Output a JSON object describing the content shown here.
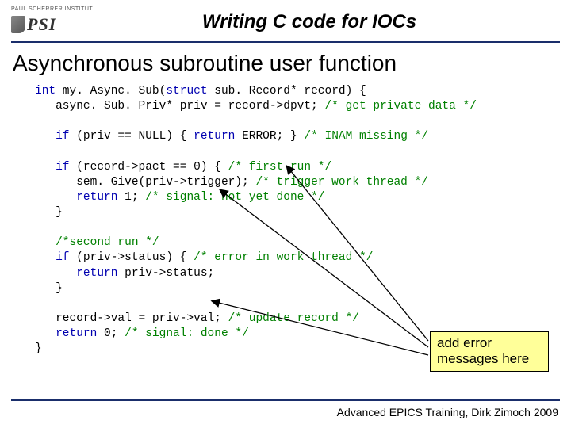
{
  "logo": {
    "institute": "PAUL SCHERRER INSTITUT",
    "letters": "PSI"
  },
  "title": "Writing C code for IOCs",
  "section": "Asynchronous subroutine user function",
  "code": {
    "l1a": "int",
    "l1b": " my. Async. Sub(",
    "l1c": "struct",
    "l1d": " sub. Record* record) {",
    "l2a": "   async. Sub. Priv* priv = record->dpvt; ",
    "l2b": "/* get private data */",
    "l3": "",
    "l4a": "   if",
    "l4b": " (priv == NULL) { ",
    "l4c": "return",
    "l4d": " ERROR; } ",
    "l4e": "/* INAM missing */",
    "l5": "",
    "l6a": "   if",
    "l6b": " (record->pact == 0) { ",
    "l6c": "/* first run */",
    "l7a": "      sem. Give(priv->trigger); ",
    "l7b": "/* trigger work thread */",
    "l8a": "      return",
    "l8b": " 1; ",
    "l8c": "/* signal: not yet done */",
    "l9": "   }",
    "l10": "",
    "l11": "   /*second run */",
    "l12a": "   if",
    "l12b": " (priv->status) { ",
    "l12c": "/* error in work thread */",
    "l13a": "      return",
    "l13b": " priv->status;",
    "l14": "   }",
    "l15": "",
    "l16a": "   record->val = priv->val; ",
    "l16b": "/* update record */",
    "l17a": "   return",
    "l17b": " 0; ",
    "l17c": "/* signal: done */",
    "l18": "}"
  },
  "callout": "add error messages here",
  "footer": "Advanced EPICS Training, Dirk Zimoch 2009"
}
